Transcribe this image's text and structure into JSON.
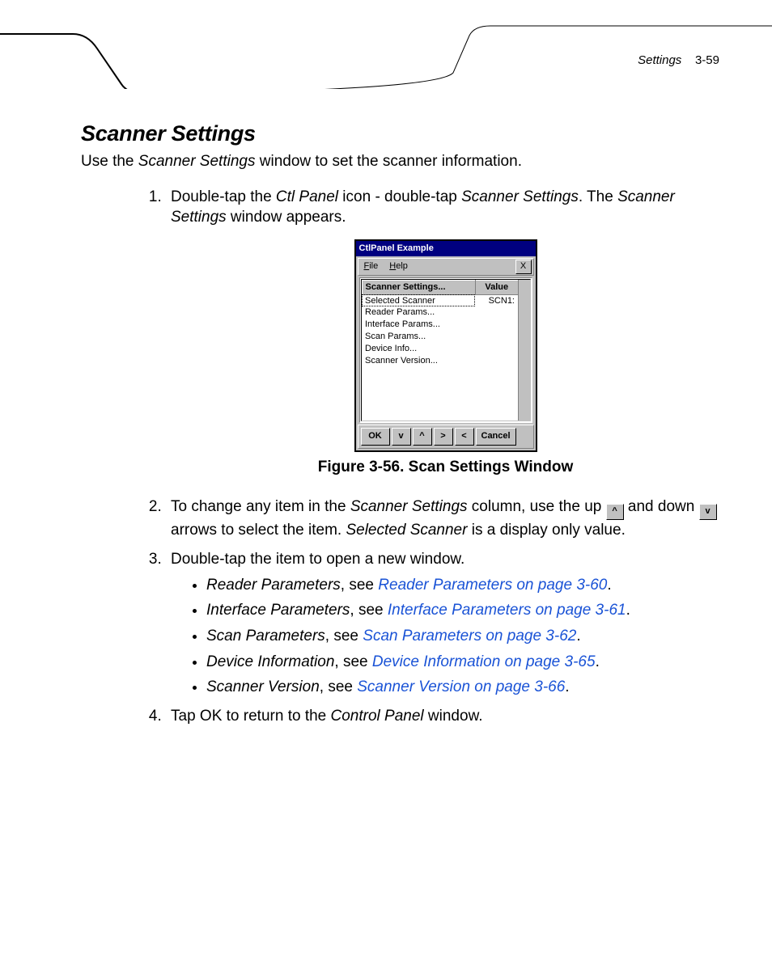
{
  "header": {
    "section": "Settings",
    "page": "3-59"
  },
  "title": "Scanner Settings",
  "intro_pre": "Use the ",
  "intro_it": "Scanner Settings",
  "intro_post": " window to set the scanner information.",
  "step1": {
    "a": "Double-tap the ",
    "b": "Ctl Panel",
    "c": " icon - double-tap ",
    "d": "Scanner Settings",
    "e": ". The ",
    "f": "Scanner Settings",
    "g": " window appears."
  },
  "win": {
    "title": "CtlPanel Example",
    "menu_file": "File",
    "menu_help": "Help",
    "close": "X",
    "col1": "Scanner Settings...",
    "col2": "Value",
    "rows": [
      {
        "name": "Selected Scanner",
        "value": "SCN1:"
      },
      {
        "name": "Reader Params...",
        "value": ""
      },
      {
        "name": "Interface Params...",
        "value": ""
      },
      {
        "name": "Scan Params...",
        "value": ""
      },
      {
        "name": "Device Info...",
        "value": ""
      },
      {
        "name": "Scanner Version...",
        "value": ""
      }
    ],
    "btn_ok": "OK",
    "btn_down": "v",
    "btn_up": "^",
    "btn_right": ">",
    "btn_left": "<",
    "btn_cancel": "Cancel"
  },
  "figure_caption": "Figure 3-56.  Scan Settings Window",
  "step2": {
    "a": "To change any item in the ",
    "b": "Scanner Settings",
    "c": " column, use the up ",
    "d": " and down ",
    "e": " arrows to select the item. ",
    "f": "Selected Scanner",
    "g": " is a display only value."
  },
  "step3": "Double-tap the item to open a new window.",
  "bullets": [
    {
      "label": "Reader Parameters",
      "mid": ", see ",
      "link": "Reader Parameters on page 3-60",
      "end": "."
    },
    {
      "label": "Interface Parameters",
      "mid": ", see ",
      "link": "Interface Parameters on page 3-61",
      "end": "."
    },
    {
      "label": "Scan Parameters",
      "mid": ", see ",
      "link": "Scan Parameters on page 3-62",
      "end": "."
    },
    {
      "label": "Device Information",
      "mid": ", see ",
      "link": "Device Information on page 3-65",
      "end": "."
    },
    {
      "label": "Scanner Version",
      "mid": ", see ",
      "link": "Scanner Version on page 3-66",
      "end": "."
    }
  ],
  "step4": {
    "a": "Tap ",
    "b": "OK",
    "c": " to return to the ",
    "d": "Control Panel",
    "e": " window."
  },
  "inline_up": "^",
  "inline_down": "v"
}
